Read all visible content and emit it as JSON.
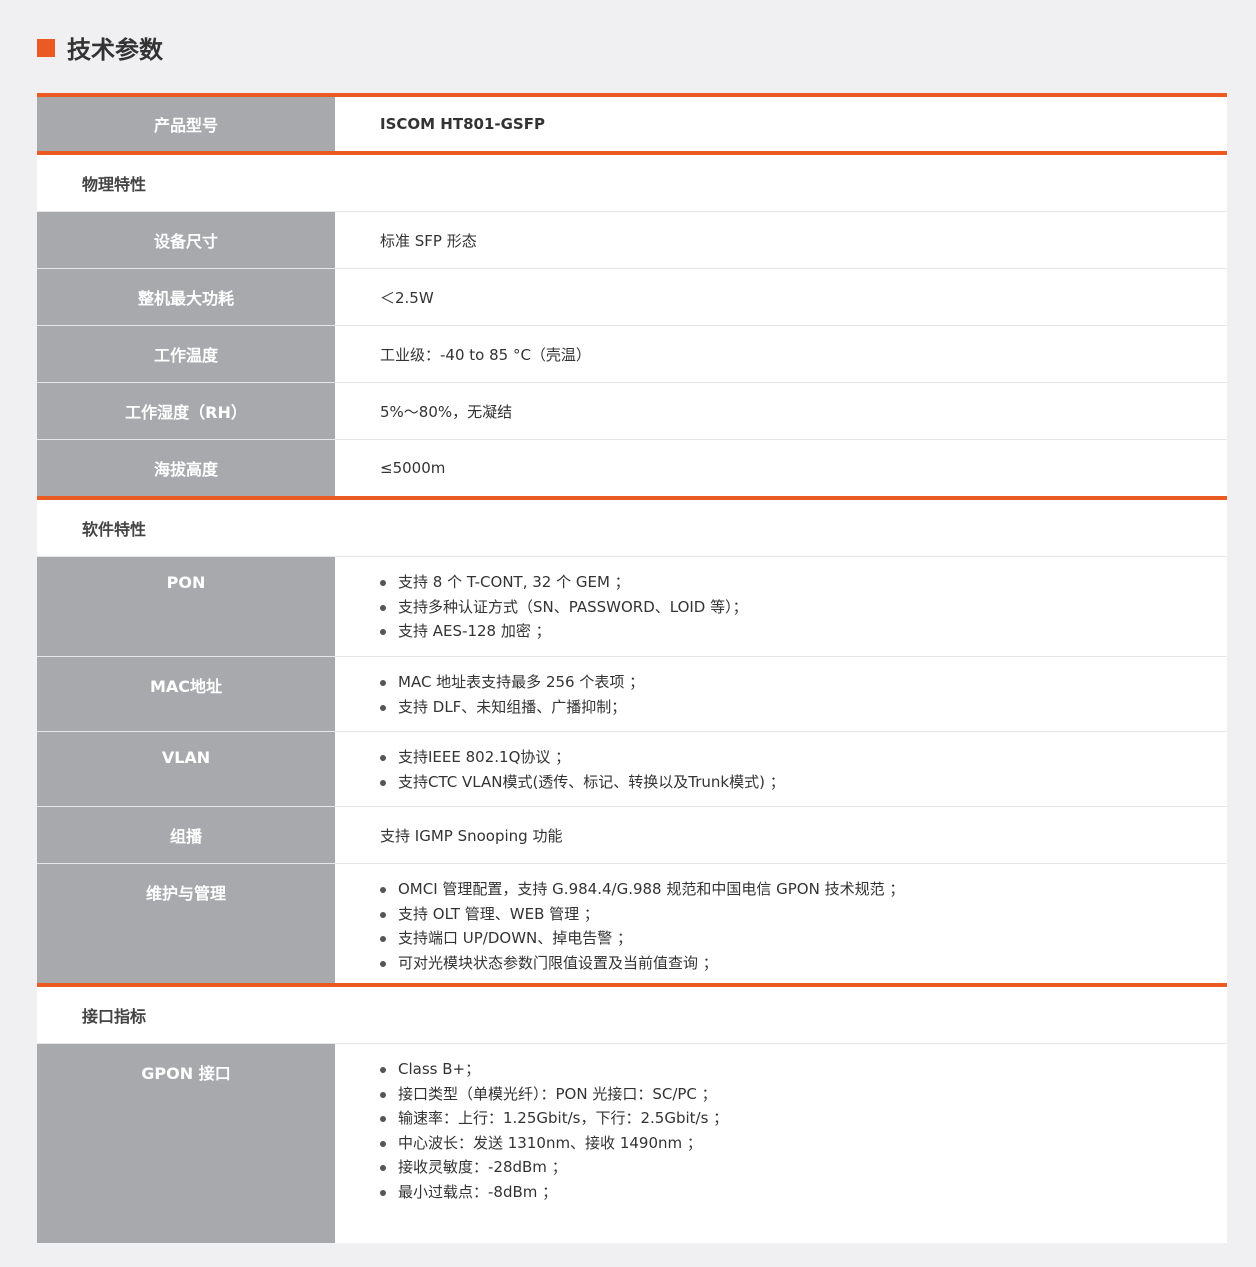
{
  "page": {
    "title": "技术参数"
  },
  "model": {
    "key": "产品型号",
    "value": "ISCOM HT801-GSFP"
  },
  "sections": {
    "physical": {
      "title": "物理特性",
      "rows": [
        {
          "key": "设备尺寸",
          "value": "标准 SFP 形态"
        },
        {
          "key": "整机最大功耗",
          "value": "＜2.5W"
        },
        {
          "key": "工作温度",
          "value": "工业级：-40 to 85 °C（壳温）"
        },
        {
          "key": "工作湿度（RH）",
          "value": "5%～80%，无凝结"
        },
        {
          "key": "海拔高度",
          "value": "≤5000m"
        }
      ]
    },
    "software": {
      "title": "软件特性",
      "pon": {
        "key": "PON",
        "items": [
          "支持 8 个 T-CONT, 32 个 GEM ；",
          "支持多种认证方式（SN、PASSWORD、LOID 等）；",
          "支持 AES-128 加密 ；"
        ]
      },
      "mac": {
        "key": "MAC地址",
        "items": [
          "MAC 地址表支持最多 256 个表项 ；",
          "支持 DLF、未知组播、广播抑制；"
        ]
      },
      "vlan": {
        "key": "VLAN",
        "items": [
          "支持IEEE 802.1Q协议 ；",
          "支持CTC VLAN模式(透传、标记、转换以及Trunk模式) ；"
        ]
      },
      "multicast": {
        "key": "组播",
        "value": "支持 IGMP Snooping 功能"
      },
      "maintenance": {
        "key": "维护与管理",
        "items": [
          "OMCI 管理配置，支持 G.984.4/G.988 规范和中国电信 GPON 技术规范 ；",
          "支持 OLT 管理、WEB 管理 ；",
          "支持端口 UP/DOWN、掉电告警 ；",
          "可对光模块状态参数门限值设置及当前值查询 ；"
        ]
      }
    },
    "interface": {
      "title": "接口指标",
      "gpon": {
        "key": "GPON 接口",
        "items": [
          "Class B+；",
          "接口类型（单模光纤）：PON 光接口：SC/PC ；",
          "输速率：上行：1.25Gbit/s，下行：2.5Gbit/s ；",
          "中心波长：发送 1310nm、接收 1490nm ；",
          "接收灵敏度：-28dBm ；",
          "最小过载点：-8dBm ；"
        ]
      }
    }
  }
}
